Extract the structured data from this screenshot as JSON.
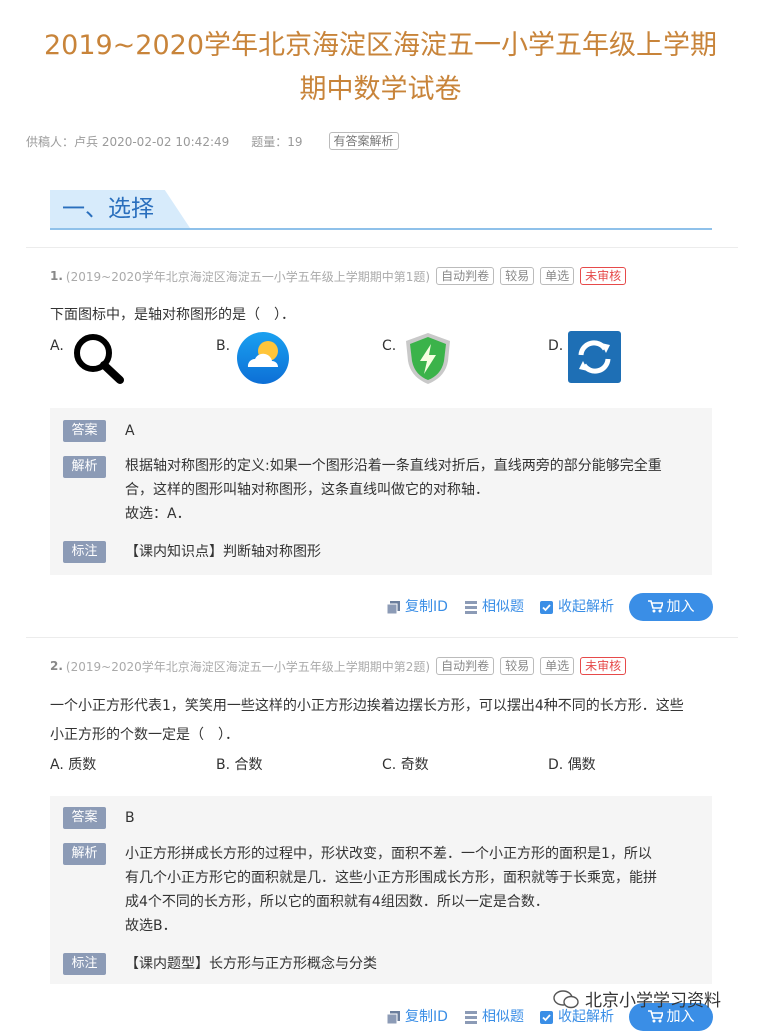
{
  "title": "2019~2020学年北京海淀区海淀五一小学五年级上学期期中数学试卷",
  "title_line1": "2019~2020学年北京海淀区海淀五一小学五年级上学期",
  "title_line2": "期中数学试卷",
  "meta": {
    "author": "供稿人：卢兵 2020-02-02 10:42:49",
    "count": "题量：19",
    "tag": "有答案解析"
  },
  "section": {
    "label": "一、选择"
  },
  "labels": {
    "answer": "答案",
    "analysis": "解析",
    "note": "标注",
    "copy_id": "复制ID",
    "similar": "相似题",
    "collapse": "收起解析",
    "add": "加入",
    "tag_auto": "自动判卷",
    "tag_easy": "较易",
    "tag_single": "单选",
    "tag_unreviewed": "未审核"
  },
  "questions": [
    {
      "num": "1.",
      "source": "(2019~2020学年北京海淀区海淀五一小学五年级上学期期中第1题)",
      "text": "下面图标中，是轴对称图形的是（　）．",
      "options": [
        {
          "letter": "A.",
          "icon": "magnifier-icon"
        },
        {
          "letter": "B.",
          "icon": "weather-icon"
        },
        {
          "letter": "C.",
          "icon": "shield-lightning-icon"
        },
        {
          "letter": "D.",
          "icon": "refresh-icon"
        }
      ],
      "answer": "A",
      "analysis_lines": [
        "根据轴对称图形的定义:如果一个图形沿着一条直线对折后，直线两旁的部分能够完全重",
        "合，这样的图形叫轴对称图形，这条直线叫做它的对称轴．",
        "故选：A．"
      ],
      "note": "【课内知识点】判断轴对称图形"
    },
    {
      "num": "2.",
      "source": "(2019~2020学年北京海淀区海淀五一小学五年级上学期期中第2题)",
      "text_lines": [
        "一个小正方形代表1，笑笑用一些这样的小正方形边挨着边摆长方形，可以摆出4种不同的长方形．这些",
        "小正方形的个数一定是（　）．"
      ],
      "options": [
        {
          "letter": "A.",
          "text": "质数"
        },
        {
          "letter": "B.",
          "text": "合数"
        },
        {
          "letter": "C.",
          "text": "奇数"
        },
        {
          "letter": "D.",
          "text": "偶数"
        }
      ],
      "answer": "B",
      "analysis_lines": [
        "小正方形拼成长方形的过程中，形状改变，面积不差．一个小正方形的面积是1，所以",
        "有几个小正方形它的面积就是几．这些小正方形围成长方形，面积就等于长乘宽，能拼",
        "成4个不同的长方形，所以它的面积就有4组因数．所以一定是合数．",
        "故选B．"
      ],
      "note": "【课内题型】长方形与正方形概念与分类"
    }
  ],
  "watermark": "北京小学学习资料",
  "colors": {
    "title": "#c8843a",
    "accent": "#3a8ee6",
    "pill": "#8c9bb6",
    "section": "#2a6fbd"
  }
}
